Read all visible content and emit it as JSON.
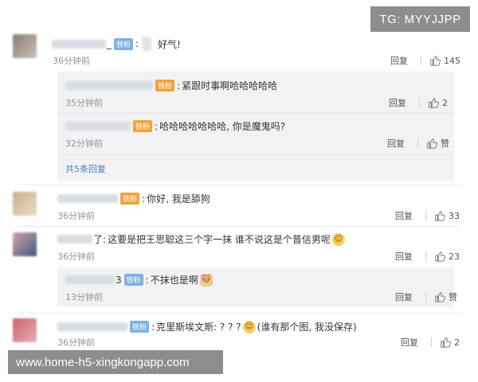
{
  "watermark": {
    "top": "TG: MYYJJPP",
    "bottom": "www.home-h5-xingkongapp.com"
  },
  "comments": [
    {
      "suffix": "_",
      "badge": "铁粉",
      "text": "好气!",
      "time": "36分钟前",
      "reply": "回复",
      "likes": "145"
    },
    {
      "badge": "铁粉",
      "text": "紧跟时事啊哈哈哈哈哈",
      "time": "35分钟前",
      "reply": "回复",
      "likes": "2"
    },
    {
      "badge": "铁粉",
      "text": "哈哈哈哈哈哈哈, 你是魔鬼吗?",
      "time": "32分钟前",
      "reply": "回复",
      "likes": "赞"
    },
    {
      "more": "共5条回复"
    },
    {
      "badge": "铁粉",
      "text": "你好, 我是舔狗",
      "time": "36分钟前",
      "reply": "回复",
      "likes": "33"
    },
    {
      "suffix": "了",
      "text": "这要是把王思聪这三个字一抹 谁不说这是个普信男呢",
      "time": "36分钟前",
      "reply": "回复",
      "likes": "23"
    },
    {
      "suffix": "3",
      "badge": "铁粉",
      "text": "不抹也是啊",
      "time": "13分钟前",
      "reply": "回复",
      "likes": "赞"
    },
    {
      "badge": "铁粉",
      "text": "克里斯埃文斯: ? ? ? ",
      "text2": "(谁有那个图, 我没保存)",
      "time": "36分钟前",
      "reply": "回复",
      "likes": "2"
    }
  ],
  "colors": {
    "badge_blue": "#7fb1e0",
    "badge_gold": "#f0a33a",
    "link": "#4a7fb5",
    "reply_bg": "#f2f2f5"
  },
  "icons": [
    "like-thumb-icon",
    "smile-emoji-icon",
    "cat-emoji-icon"
  ]
}
